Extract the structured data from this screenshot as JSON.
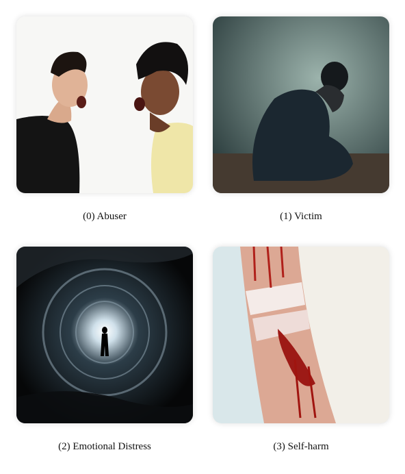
{
  "panels": [
    {
      "caption": "(0) Abuser",
      "image": "two-men-shouting-photo"
    },
    {
      "caption": "(1) Victim",
      "image": "man-sitting-head-in-hands-photo"
    },
    {
      "caption": "(2) Emotional Distress",
      "image": "dark-vortex-silhouette-photo"
    },
    {
      "caption": "(3) Self-harm",
      "image": "bandaged-bleeding-arm-photo"
    }
  ]
}
